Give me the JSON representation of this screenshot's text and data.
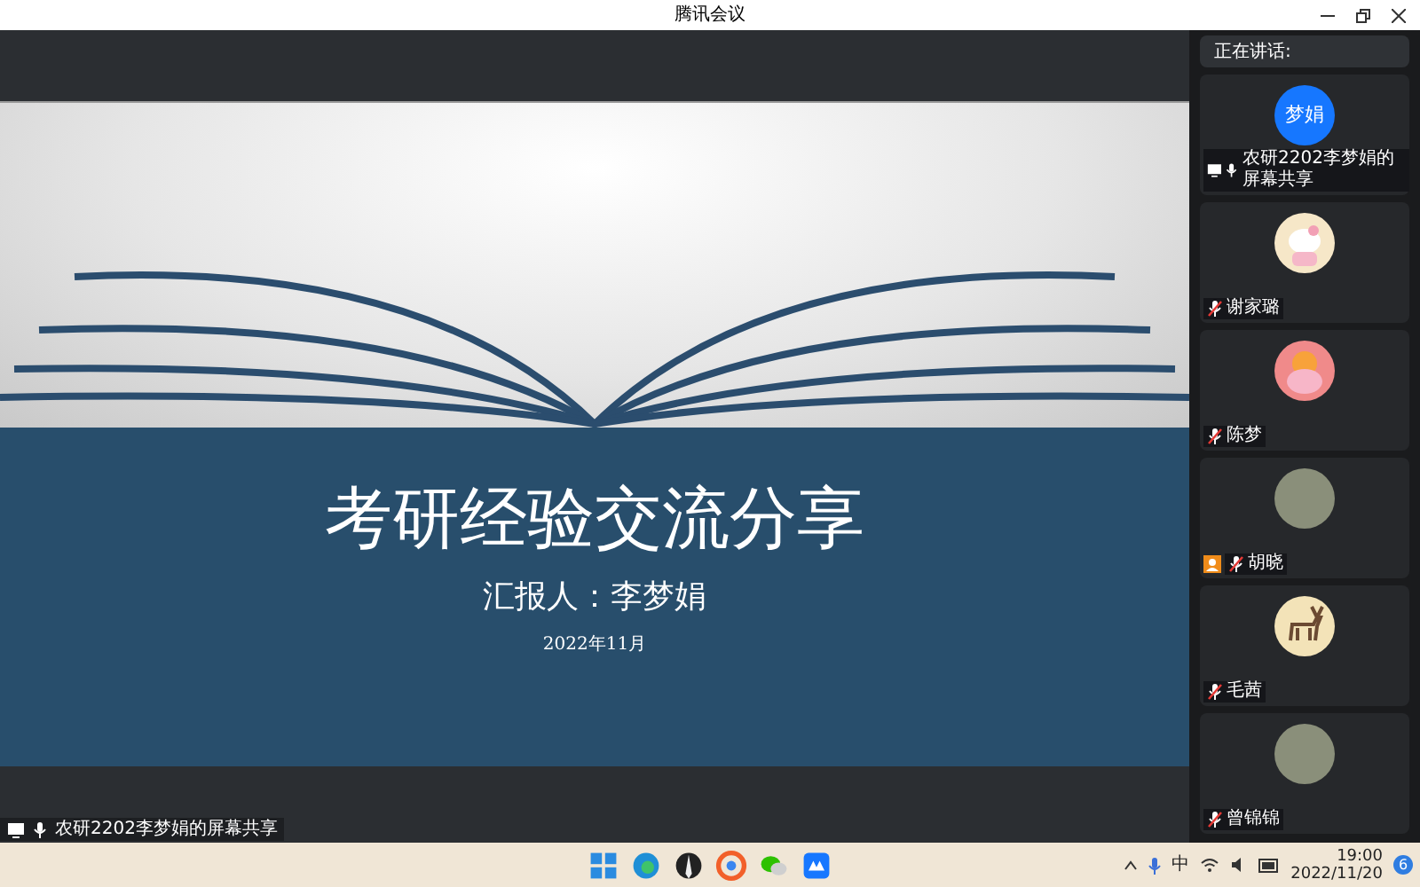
{
  "window": {
    "title": "腾讯会议"
  },
  "slide": {
    "title": "考研经验交流分享",
    "presenter": "汇报人：李梦娟",
    "date": "2022年11月"
  },
  "share_label": "农研2202李梦娟的屏幕共享",
  "speaking_bar": {
    "label": "正在讲话:"
  },
  "participants": [
    {
      "name": "农研2202李梦娟的屏幕共享",
      "kind": "text",
      "avatar_text": "梦娟",
      "sharing": true,
      "muted": false,
      "host": false
    },
    {
      "name": "谢家璐",
      "kind": "cartoon-cat",
      "sharing": false,
      "muted": true,
      "host": false
    },
    {
      "name": "陈梦",
      "kind": "cartoon-pink",
      "sharing": false,
      "muted": true,
      "host": false
    },
    {
      "name": "胡晓",
      "kind": "photo",
      "sharing": false,
      "muted": true,
      "host": true
    },
    {
      "name": "毛茜",
      "kind": "deer",
      "sharing": false,
      "muted": true,
      "host": false
    },
    {
      "name": "曾锦锦",
      "kind": "photo",
      "sharing": false,
      "muted": true,
      "host": false
    }
  ],
  "taskbar": {
    "apps": [
      {
        "kind": "start"
      },
      {
        "kind": "edge"
      },
      {
        "kind": "pen"
      },
      {
        "kind": "chrome"
      },
      {
        "kind": "wechat"
      },
      {
        "kind": "meeting"
      }
    ],
    "input_method": "中",
    "time": "19:00",
    "date": "2022/11/20",
    "notifications": "6"
  }
}
